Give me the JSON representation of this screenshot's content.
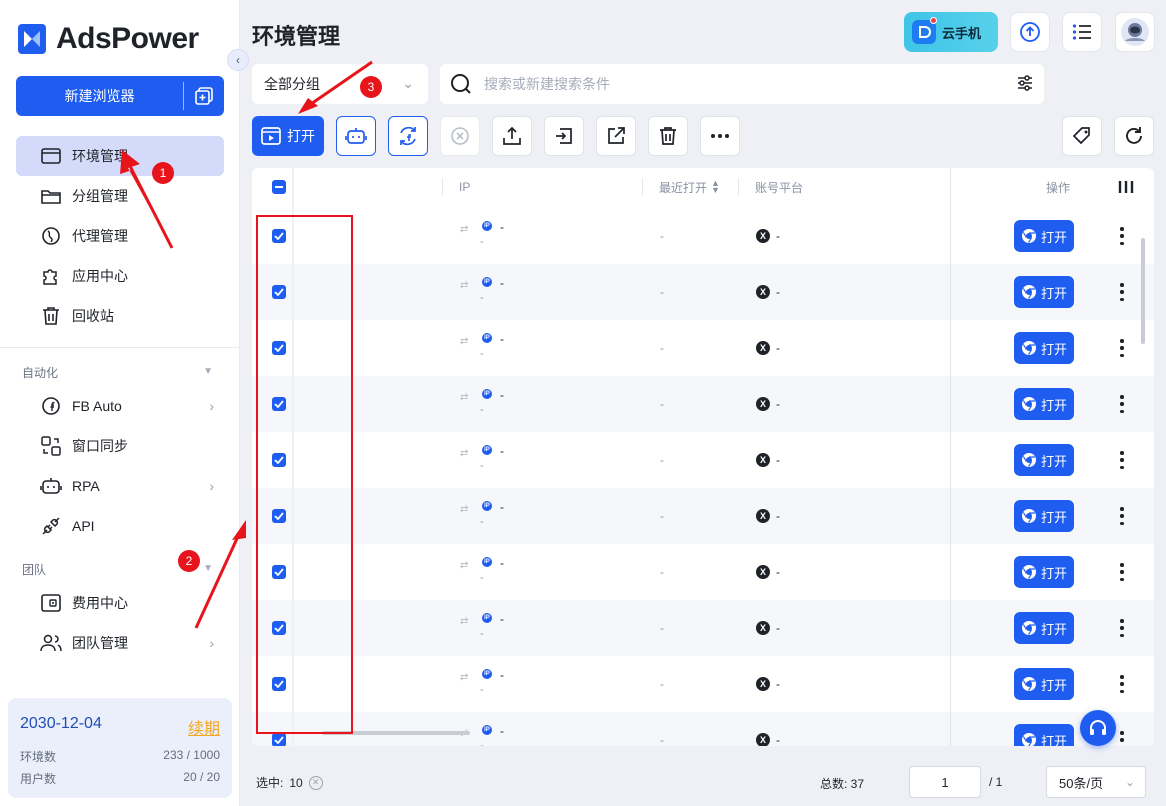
{
  "sidebar": {
    "brand": "AdsPower",
    "new_browser_label": "新建浏览器",
    "nav": [
      {
        "label": "环境管理",
        "icon": "browser-window-icon",
        "active": true
      },
      {
        "label": "分组管理",
        "icon": "folder-icon"
      },
      {
        "label": "代理管理",
        "icon": "proxy-icon"
      },
      {
        "label": "应用中心",
        "icon": "puzzle-icon"
      },
      {
        "label": "回收站",
        "icon": "trash-icon"
      }
    ],
    "automation_title": "自动化",
    "automation": [
      {
        "label": "FB Auto",
        "icon": "facebook-auto-icon"
      },
      {
        "label": "窗口同步",
        "icon": "window-sync-icon"
      },
      {
        "label": "RPA",
        "icon": "robot-icon"
      },
      {
        "label": "API",
        "icon": "api-plug-icon"
      }
    ],
    "team_title": "团队",
    "team": [
      {
        "label": "费用中心",
        "icon": "billing-icon"
      },
      {
        "label": "团队管理",
        "icon": "team-icon"
      }
    ],
    "plan": {
      "expiry": "2030-12-04",
      "renew_label": "续期",
      "profiles_label": "环境数",
      "profiles_value": "233 / 1000",
      "users_label": "用户数",
      "users_value": "20 / 20"
    }
  },
  "header": {
    "title": "环境管理",
    "cloud_phone_label": "云手机"
  },
  "filters": {
    "group_value": "全部分组",
    "search_placeholder": "搜索或新建搜索条件"
  },
  "toolbar": {
    "open_label": "打开"
  },
  "table": {
    "columns": {
      "ip": "IP",
      "last_open": "最近打开",
      "platform": "账号平台",
      "actions": "操作"
    },
    "rows": [
      {
        "ip": "-",
        "ip_sub": "-",
        "last_open": "-",
        "platform": "-",
        "open_label": "打开",
        "checked": true
      },
      {
        "ip": "-",
        "ip_sub": "-",
        "last_open": "-",
        "platform": "-",
        "open_label": "打开",
        "checked": true
      },
      {
        "ip": "-",
        "ip_sub": "-",
        "last_open": "-",
        "platform": "-",
        "open_label": "打开",
        "checked": true
      },
      {
        "ip": "-",
        "ip_sub": "-",
        "last_open": "-",
        "platform": "-",
        "open_label": "打开",
        "checked": true
      },
      {
        "ip": "-",
        "ip_sub": "-",
        "last_open": "-",
        "platform": "-",
        "open_label": "打开",
        "checked": true
      },
      {
        "ip": "-",
        "ip_sub": "-",
        "last_open": "-",
        "platform": "-",
        "open_label": "打开",
        "checked": true
      },
      {
        "ip": "-",
        "ip_sub": "-",
        "last_open": "-",
        "platform": "-",
        "open_label": "打开",
        "checked": true
      },
      {
        "ip": "-",
        "ip_sub": "-",
        "last_open": "-",
        "platform": "-",
        "open_label": "打开",
        "checked": true
      },
      {
        "ip": "-",
        "ip_sub": "-",
        "last_open": "-",
        "platform": "-",
        "open_label": "打开",
        "checked": true
      },
      {
        "ip": "-",
        "ip_sub": "-",
        "last_open": "-",
        "platform": "-",
        "open_label": "打开",
        "checked": true
      }
    ]
  },
  "footer": {
    "selected_label": "选中:",
    "selected_count": "10",
    "total_label": "总数: 37",
    "current_page": "1",
    "page_total": "/ 1",
    "page_size": "50条/页"
  },
  "annotations": [
    "1",
    "2",
    "3"
  ],
  "colors": {
    "primary": "#1f5cf0",
    "annotation_red": "#e8141b",
    "renew_orange": "#f5a623"
  }
}
